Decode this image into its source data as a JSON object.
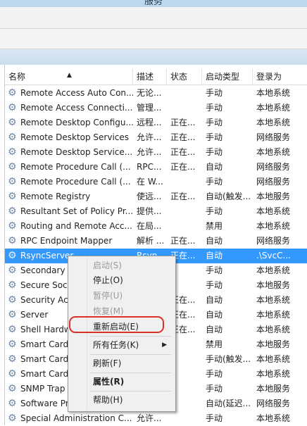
{
  "window": {
    "title": "服务"
  },
  "columns": {
    "name": "名称",
    "description": "描述",
    "status": "状态",
    "startup": "启动类型",
    "logon": "登录为"
  },
  "services": [
    {
      "name": "Remote Access Auto Con...",
      "description": "无论...",
      "status": "",
      "startup": "手动",
      "logon": "本地系统"
    },
    {
      "name": "Remote Access Connecti...",
      "description": "管理...",
      "status": "",
      "startup": "手动",
      "logon": "本地系统"
    },
    {
      "name": "Remote Desktop Configu...",
      "description": "远程...",
      "status": "正在...",
      "startup": "手动",
      "logon": "本地系统"
    },
    {
      "name": "Remote Desktop Services",
      "description": "允许...",
      "status": "正在...",
      "startup": "手动",
      "logon": "网络服务"
    },
    {
      "name": "Remote Desktop Service...",
      "description": "允许...",
      "status": "正在...",
      "startup": "手动",
      "logon": "本地系统"
    },
    {
      "name": "Remote Procedure Call (...",
      "description": "RPC...",
      "status": "正在...",
      "startup": "自动",
      "logon": "网络服务"
    },
    {
      "name": "Remote Procedure Call (...",
      "description": "在 W...",
      "status": "",
      "startup": "手动",
      "logon": "网络服务"
    },
    {
      "name": "Remote Registry",
      "description": "使远...",
      "status": "正在...",
      "startup": "自动(触发...",
      "logon": "本地服务"
    },
    {
      "name": "Resultant Set of Policy Pr...",
      "description": "提供...",
      "status": "",
      "startup": "手动",
      "logon": "本地系统"
    },
    {
      "name": "Routing and Remote Acc...",
      "description": "在局...",
      "status": "",
      "startup": "禁用",
      "logon": "本地系统"
    },
    {
      "name": "RPC Endpoint Mapper",
      "description": "解析 ...",
      "status": "正在...",
      "startup": "自动",
      "logon": "网络服务"
    },
    {
      "name": "RsyncServer",
      "description": "Rsyn...",
      "status": "正在...",
      "startup": "自动",
      "logon": ".\\SvcC..."
    },
    {
      "name": "Secondary L",
      "description": "",
      "status": "",
      "startup": "手动",
      "logon": "本地系统"
    },
    {
      "name": "Secure Sock",
      "description": "",
      "status": "",
      "startup": "手动",
      "logon": "本地服务"
    },
    {
      "name": "Security Acc",
      "description": "",
      "status": "正在...",
      "startup": "自动",
      "logon": "本地系统"
    },
    {
      "name": "Server",
      "description": "",
      "status": "正在...",
      "startup": "自动",
      "logon": "本地系统"
    },
    {
      "name": "Shell Hardw",
      "description": "",
      "status": "正在...",
      "startup": "自动",
      "logon": "本地系统"
    },
    {
      "name": "Smart Card",
      "description": "",
      "status": "",
      "startup": "禁用",
      "logon": "本地服务"
    },
    {
      "name": "Smart Card",
      "description": "",
      "status": "",
      "startup": "手动(触发...",
      "logon": "本地系统"
    },
    {
      "name": "Smart Card",
      "description": "",
      "status": "",
      "startup": "手动",
      "logon": "本地系统"
    },
    {
      "name": "SNMP Trap",
      "description": "",
      "status": "",
      "startup": "手动",
      "logon": "本地服务"
    },
    {
      "name": "Software Pr",
      "description": "",
      "status": "",
      "startup": "自动(延迟...",
      "logon": "网络服务"
    },
    {
      "name": "Special Administration C...",
      "description": "允许...",
      "status": "",
      "startup": "手动",
      "logon": "本地系统"
    }
  ],
  "selected_index": 11,
  "context_menu": {
    "start": "启动(S)",
    "stop": "停止(O)",
    "pause": "暂停(U)",
    "resume": "恢复(M)",
    "restart": "重新启动(E)",
    "all_tasks": "所有任务(K)",
    "refresh": "刷新(F)",
    "properties": "属性(R)",
    "help": "帮助(H)"
  },
  "colors": {
    "selection": "#3399ff",
    "highlight_ring": "#d9302a"
  }
}
